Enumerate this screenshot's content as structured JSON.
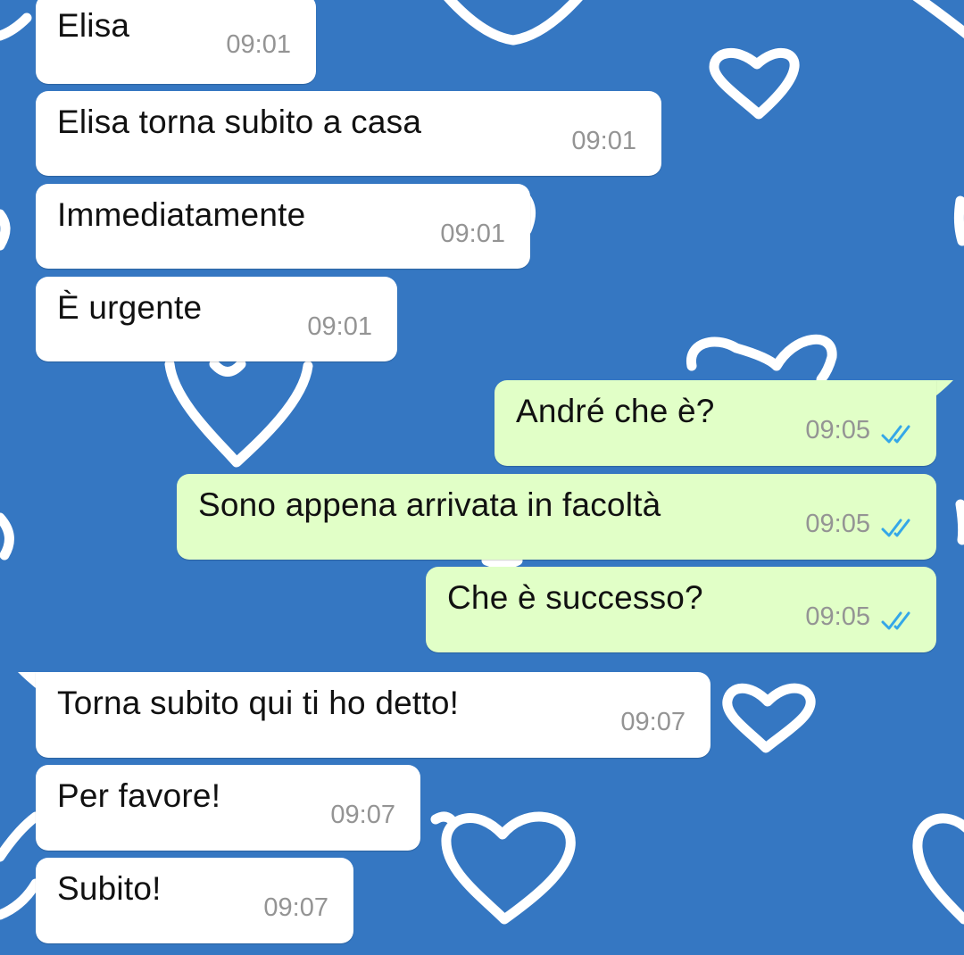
{
  "colors": {
    "background": "#3577c2",
    "incoming_bubble": "#ffffff",
    "outgoing_bubble": "#e1ffc7",
    "timestamp": "#949494",
    "read_ticks": "#34a7e8",
    "heart_doodle": "#ffffff"
  },
  "background_pattern": "heart-doodles",
  "messages": [
    {
      "direction": "incoming",
      "text": "Elisa",
      "time": "09:01"
    },
    {
      "direction": "incoming",
      "text": "Elisa torna subito a casa",
      "time": "09:01"
    },
    {
      "direction": "incoming",
      "text": "Immediatamente",
      "time": "09:01"
    },
    {
      "direction": "incoming",
      "text": "È urgente",
      "time": "09:01"
    },
    {
      "direction": "outgoing",
      "text": "André che è?",
      "time": "09:05",
      "status_icon": "double-check-read-icon"
    },
    {
      "direction": "outgoing",
      "text": "Sono appena arrivata in facoltà",
      "time": "09:05",
      "status_icon": "double-check-read-icon"
    },
    {
      "direction": "outgoing",
      "text": "Che è successo?",
      "time": "09:05",
      "status_icon": "double-check-read-icon"
    },
    {
      "direction": "incoming",
      "text": "Torna subito qui ti ho detto!",
      "time": "09:07"
    },
    {
      "direction": "incoming",
      "text": "Per favore!",
      "time": "09:07"
    },
    {
      "direction": "incoming",
      "text": "Subito!",
      "time": "09:07"
    }
  ]
}
